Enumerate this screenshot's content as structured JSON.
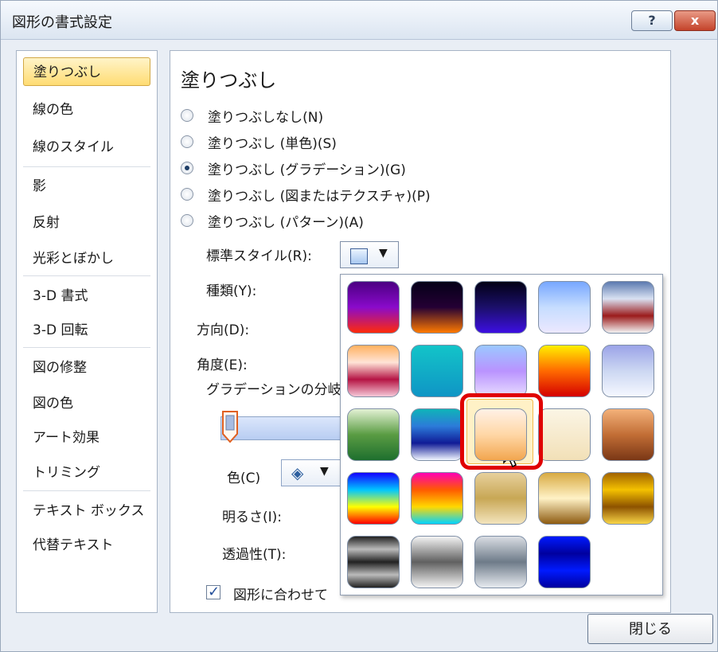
{
  "window": {
    "title": "図形の書式設定",
    "help": "?",
    "close": "x"
  },
  "sidebar": {
    "items": [
      {
        "label": "塗りつぶし",
        "active": true
      },
      {
        "label": "線の色"
      },
      {
        "label": "線のスタイル"
      },
      {
        "label": "影"
      },
      {
        "label": "反射"
      },
      {
        "label": "光彩とぼかし"
      },
      {
        "label": "3-D 書式"
      },
      {
        "label": "3-D 回転"
      },
      {
        "label": "図の修整"
      },
      {
        "label": "図の色"
      },
      {
        "label": "アート効果"
      },
      {
        "label": "トリミング"
      },
      {
        "label": "テキスト ボックス"
      },
      {
        "label": "代替テキスト"
      }
    ]
  },
  "panel": {
    "heading": "塗りつぶし",
    "options": [
      {
        "label": "塗りつぶしなし(N)"
      },
      {
        "label": "塗りつぶし (単色)(S)"
      },
      {
        "label": "塗りつぶし (グラデーション)(G)",
        "checked": true
      },
      {
        "label": "塗りつぶし (図またはテクスチャ)(P)"
      },
      {
        "label": "塗りつぶし (パターン)(A)"
      }
    ],
    "preset_label": "標準スタイル(R):",
    "type_label": "種類(Y):",
    "direction_label": "方向(D):",
    "angle_label": "角度(E):",
    "stops_label": "グラデーションの分岐",
    "color_label": "色(C)",
    "brightness_label": "明るさ(I):",
    "transparency_label": "透過性(T):",
    "rotate_label": "図形に合わせて",
    "close_button": "閉じる"
  },
  "gallery": {
    "selected_index": 12,
    "swatches": [
      {
        "gradient": "linear-gradient(#4b0082,#8a0acb,#ff2a0a)"
      },
      {
        "gradient": "linear-gradient(#050018,#240034,#ff7a00)"
      },
      {
        "gradient": "linear-gradient(#020015,#1b0f6a,#3d0fe2)"
      },
      {
        "gradient": "linear-gradient(#77a7ff,#c6ddff,#ece8ff)"
      },
      {
        "gradient": "linear-gradient(#5c7ab0,#d9e1f2,#9b1c1c,#f3f3f3)"
      },
      {
        "gradient": "linear-gradient(#ffb15f,#ffe4d7,#b51444,#f6c8d8)"
      },
      {
        "gradient": "linear-gradient(#13c4c8,#0f95c5)"
      },
      {
        "gradient": "linear-gradient(#9bc8ff,#b993ff,#e8ddff)"
      },
      {
        "gradient": "linear-gradient(#ffef00,#ff6a00,#d40000)"
      },
      {
        "gradient": "linear-gradient(#9ba3e8,#ccd7f2,#f5f8ff)"
      },
      {
        "gradient": "linear-gradient(#e3f1d4,#5a9c43,#1e6f2e)"
      },
      {
        "gradient": "linear-gradient(#0fb3b8,#2c7bd9,#101b96,#f2f7ff)"
      },
      {
        "gradient": "linear-gradient(#fff1e6,#ffd7a6,#f2a64f)"
      },
      {
        "gradient": "linear-gradient(#fbf5e5,#f2e0b7)"
      },
      {
        "gradient": "linear-gradient(#f3b17a,#c26e36,#7a3716)"
      },
      {
        "gradient": "linear-gradient(#1400ff,#00c6ff,#ffff00,#ff0000)"
      },
      {
        "gradient": "linear-gradient(#ff00b4,#ff5b00,#ffd800,#00d4ff)"
      },
      {
        "gradient": "linear-gradient(#e7d09c,#c8a755,#f3e4bd)"
      },
      {
        "gradient": "linear-gradient(#d8aa42,#fff2c6,#8d5b11)"
      },
      {
        "gradient": "linear-gradient(#a26300,#f4c100,#8d5200,#f9d547)"
      },
      {
        "gradient": "linear-gradient(#222,#bbb,#222,#bbb,#222)"
      },
      {
        "gradient": "linear-gradient(#f4f4f4,#606060,#f4f4f4)"
      },
      {
        "gradient": "linear-gradient(#d9dde3,#6e7b89,#e7ebf0)"
      },
      {
        "gradient": "linear-gradient(#001aff,#00009f,#001aff,#00009f)"
      }
    ]
  }
}
